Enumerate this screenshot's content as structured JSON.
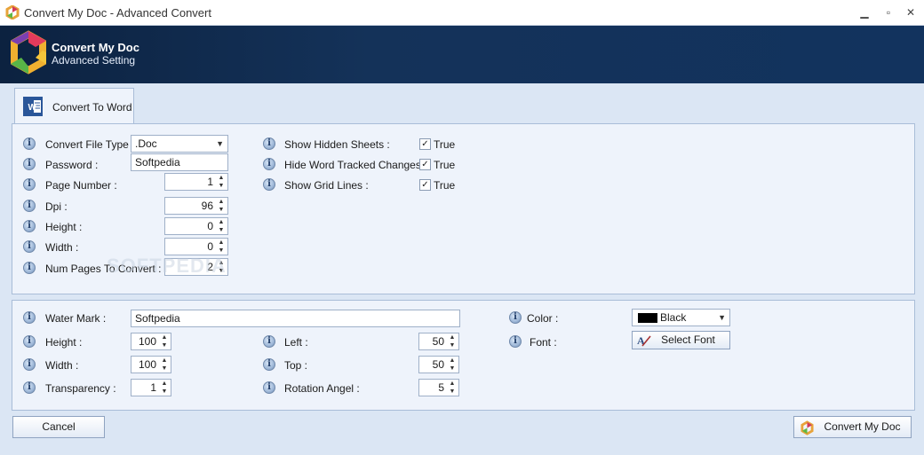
{
  "window": {
    "title": "Convert My Doc - Advanced Convert",
    "minimize": "▁",
    "maximize": "▫",
    "close": "✕"
  },
  "header": {
    "title": "Convert My Doc",
    "subtitle": "Advanced Setting"
  },
  "tab": {
    "label": "Convert To Word",
    "icon": "word-icon"
  },
  "panel1": {
    "convert_file_type": {
      "label": "Convert File Type :",
      "value": ".Doc"
    },
    "password": {
      "label": "Password :",
      "value": "Softpedia"
    },
    "page_number": {
      "label": "Page Number :",
      "value": "1"
    },
    "dpi": {
      "label": "Dpi :",
      "value": "96"
    },
    "height": {
      "label": "Height :",
      "value": "0"
    },
    "width": {
      "label": "Width :",
      "value": "0"
    },
    "num_pages": {
      "label": "Num Pages To Convert :",
      "value": "2"
    },
    "show_hidden_sheets": {
      "label": "Show Hidden Sheets :",
      "value": "True",
      "checked": true
    },
    "hide_tracked_changes": {
      "label": "Hide Word Tracked Changes :",
      "value": "True",
      "checked": true
    },
    "show_grid_lines": {
      "label": "Show Grid Lines :",
      "value": "True",
      "checked": true
    }
  },
  "panel2": {
    "watermark": {
      "label": "Water Mark :",
      "value": "Softpedia"
    },
    "height": {
      "label": "Height :",
      "value": "100"
    },
    "width": {
      "label": "Width :",
      "value": "100"
    },
    "transparency": {
      "label": "Transparency :",
      "value": "1"
    },
    "left": {
      "label": "Left :",
      "value": "50"
    },
    "top": {
      "label": "Top :",
      "value": "50"
    },
    "rotation": {
      "label": "Rotation Angel :",
      "value": "5"
    },
    "color": {
      "label": "Color :",
      "value": "Black",
      "swatch": "#000000"
    },
    "font": {
      "label": "Font :",
      "button": "Select Font"
    }
  },
  "footer": {
    "cancel": "Cancel",
    "convert": "Convert My Doc"
  },
  "watermark_text": "SOFTPEDIA",
  "colors": {
    "header_bg": "#143259",
    "panel_bg": "#eef3fb",
    "window_bg": "#dbe6f4"
  }
}
